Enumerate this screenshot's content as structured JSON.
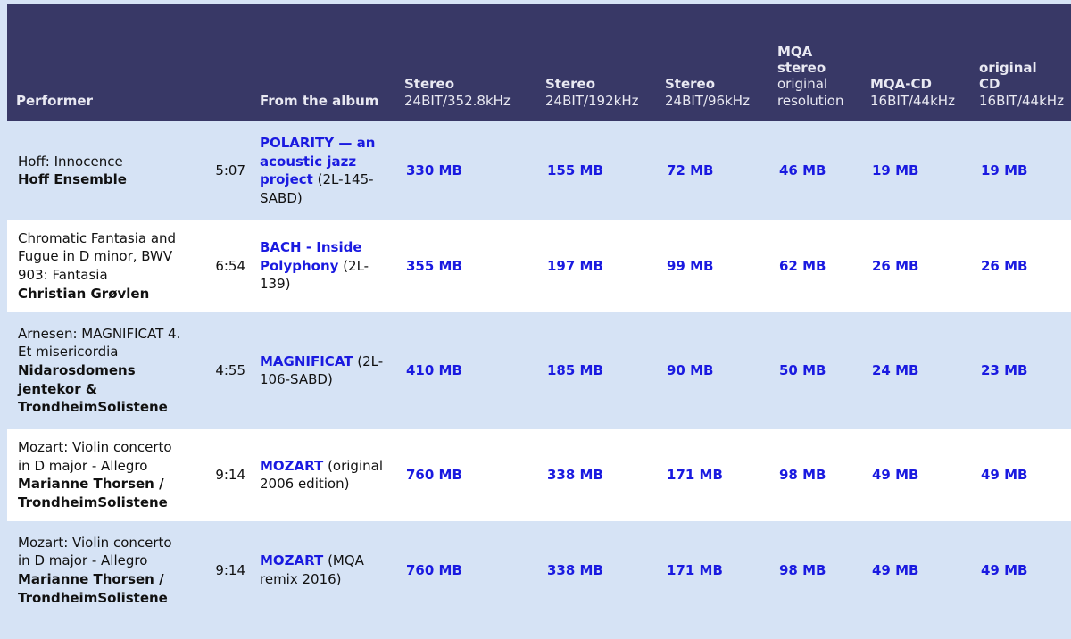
{
  "table": {
    "columns": [
      {
        "key": "performer",
        "main": "Performer",
        "sub": ""
      },
      {
        "key": "time",
        "main": "",
        "sub": ""
      },
      {
        "key": "album",
        "main": "From the album",
        "sub": ""
      },
      {
        "key": "stereo_352",
        "main": "Stereo",
        "sub": "24BIT/352.8kHz"
      },
      {
        "key": "stereo_192",
        "main": "Stereo",
        "sub": "24BIT/192kHz"
      },
      {
        "key": "stereo_96",
        "main": "Stereo",
        "sub": "24BIT/96kHz"
      },
      {
        "key": "mqa_stereo",
        "main": "MQA stereo",
        "sub": "original resolution"
      },
      {
        "key": "mqa_cd",
        "main": "MQA-CD",
        "sub": "16BIT/44kHz"
      },
      {
        "key": "original_cd",
        "main": "original CD",
        "sub": "16BIT/44kHz"
      }
    ],
    "rows": [
      {
        "track_title": "Hoff: Innocence",
        "artist": "Hoff Ensemble",
        "duration": "5:07",
        "album_name": "POLARITY — an acoustic jazz project",
        "album_code": "(2L-145-SABD)",
        "stereo_352": "330 MB",
        "stereo_192": "155 MB",
        "stereo_96": "72 MB",
        "mqa_stereo": "46 MB",
        "mqa_cd": "19 MB",
        "original_cd": "19 MB"
      },
      {
        "track_title": "Chromatic Fantasia and Fugue in D minor, BWV 903: Fantasia",
        "artist": "Christian Grøvlen",
        "duration": "6:54",
        "album_name": "BACH - Inside Polyphony",
        "album_code": "(2L-139)",
        "stereo_352": "355 MB",
        "stereo_192": "197 MB",
        "stereo_96": "99 MB",
        "mqa_stereo": "62 MB",
        "mqa_cd": "26 MB",
        "original_cd": "26 MB"
      },
      {
        "track_title": "Arnesen: MAGNIFICAT 4. Et misericordia",
        "artist": "Nidarosdomens jentekor & TrondheimSolistene",
        "duration": "4:55",
        "album_name": "MAGNIFICAT",
        "album_code": "(2L-106-SABD)",
        "stereo_352": "410 MB",
        "stereo_192": "185 MB",
        "stereo_96": "90 MB",
        "mqa_stereo": "50 MB",
        "mqa_cd": "24 MB",
        "original_cd": "23 MB"
      },
      {
        "track_title": "Mozart: Violin concerto in D major - Allegro",
        "artist": "Marianne Thorsen / TrondheimSolistene",
        "duration": "9:14",
        "album_name": "MOZART",
        "album_code": "(original 2006 edition)",
        "stereo_352": "760 MB",
        "stereo_192": "338 MB",
        "stereo_96": "171 MB",
        "mqa_stereo": "98 MB",
        "mqa_cd": "49 MB",
        "original_cd": "49 MB"
      },
      {
        "track_title": "Mozart: Violin concerto in D major - Allegro",
        "artist": "Marianne Thorsen / TrondheimSolistene",
        "duration": "9:14",
        "album_name": "MOZART",
        "album_code": "(MQA remix 2016)",
        "stereo_352": "760 MB",
        "stereo_192": "338 MB",
        "stereo_96": "171 MB",
        "mqa_stereo": "98 MB",
        "mqa_cd": "49 MB",
        "original_cd": "49 MB"
      }
    ]
  },
  "colors": {
    "header_bg": "#383866",
    "header_text": "#e9e9f2",
    "row_alt_bg": "#d6e3f5",
    "row_bg": "#ffffff",
    "link_blue": "#1a1ae0",
    "page_bg": "#d6e3f5",
    "body_text": "#111111"
  }
}
